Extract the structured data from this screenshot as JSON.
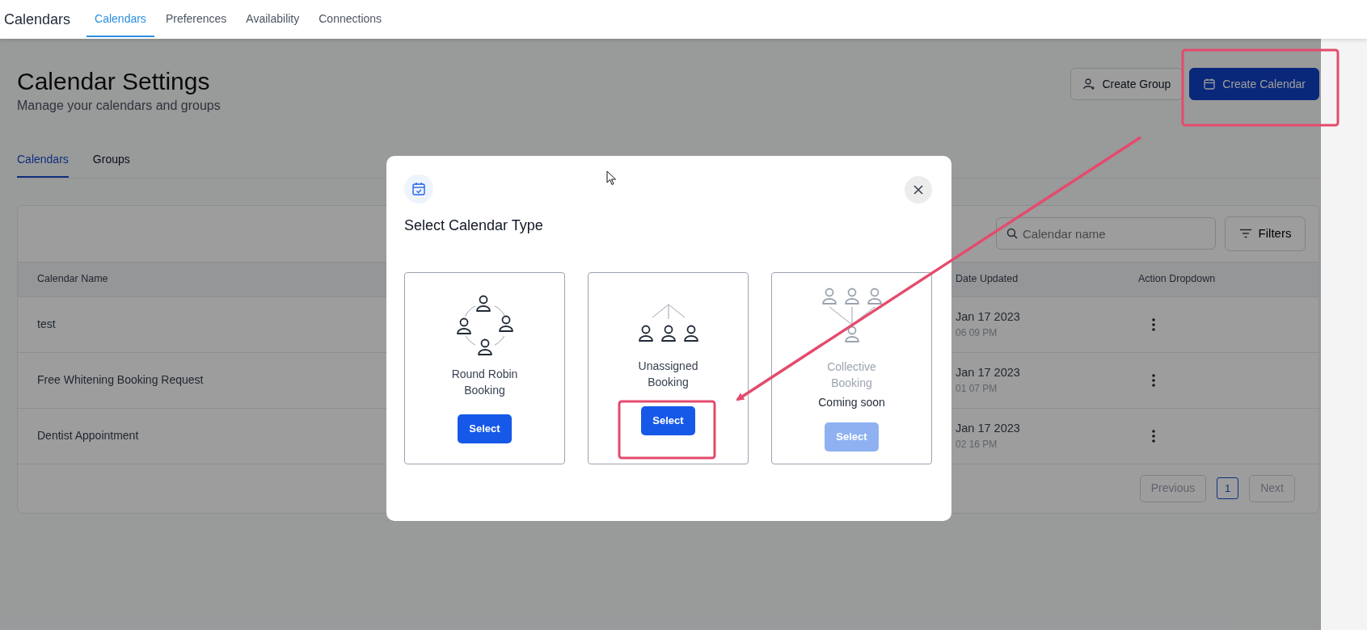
{
  "app": {
    "title": "Calendars",
    "nav": [
      {
        "label": "Calendars",
        "selected": true
      },
      {
        "label": "Preferences",
        "selected": false
      },
      {
        "label": "Availability",
        "selected": false
      },
      {
        "label": "Connections",
        "selected": false
      }
    ]
  },
  "page": {
    "title": "Calendar Settings",
    "subtitle": "Manage your calendars and groups",
    "buttons": [
      {
        "label": "Create Group",
        "kind": "secondary"
      },
      {
        "label": "Create Calendar",
        "kind": "primary"
      }
    ],
    "tabs": [
      {
        "label": "Calendars",
        "selected": true
      },
      {
        "label": "Groups",
        "selected": false
      }
    ],
    "search": {
      "placeholder": "Calendar name"
    },
    "filters_button": "Filters",
    "table": {
      "columns": [
        "Calendar Name",
        "Date Updated",
        "Action Dropdown"
      ],
      "rows": [
        {
          "name": "test",
          "date": "Jan 17 2023",
          "time": "06 09 PM"
        },
        {
          "name": "Free Whitening Booking Request",
          "date": "Jan 17 2023",
          "time": "01 07 PM"
        },
        {
          "name": "Dentist Appointment",
          "date": "Jan 17 2023",
          "time": "02 16 PM"
        }
      ]
    },
    "pagination": {
      "previous": {
        "label": "Previous",
        "disabled": true
      },
      "pages": [
        {
          "label": "1",
          "selected": true
        }
      ],
      "next": {
        "label": "Next",
        "disabled": true
      }
    }
  },
  "modal": {
    "title": "Select Calendar Type",
    "options": [
      {
        "kind": "round-robin",
        "title": "Round Robin Booking",
        "button": "Select",
        "disabled": false
      },
      {
        "kind": "unassigned",
        "title": "Unassigned Booking",
        "button": "Select",
        "disabled": false
      },
      {
        "kind": "collective",
        "title": "Collective Booking",
        "note": "Coming soon",
        "button": "Select",
        "disabled": true
      }
    ]
  }
}
